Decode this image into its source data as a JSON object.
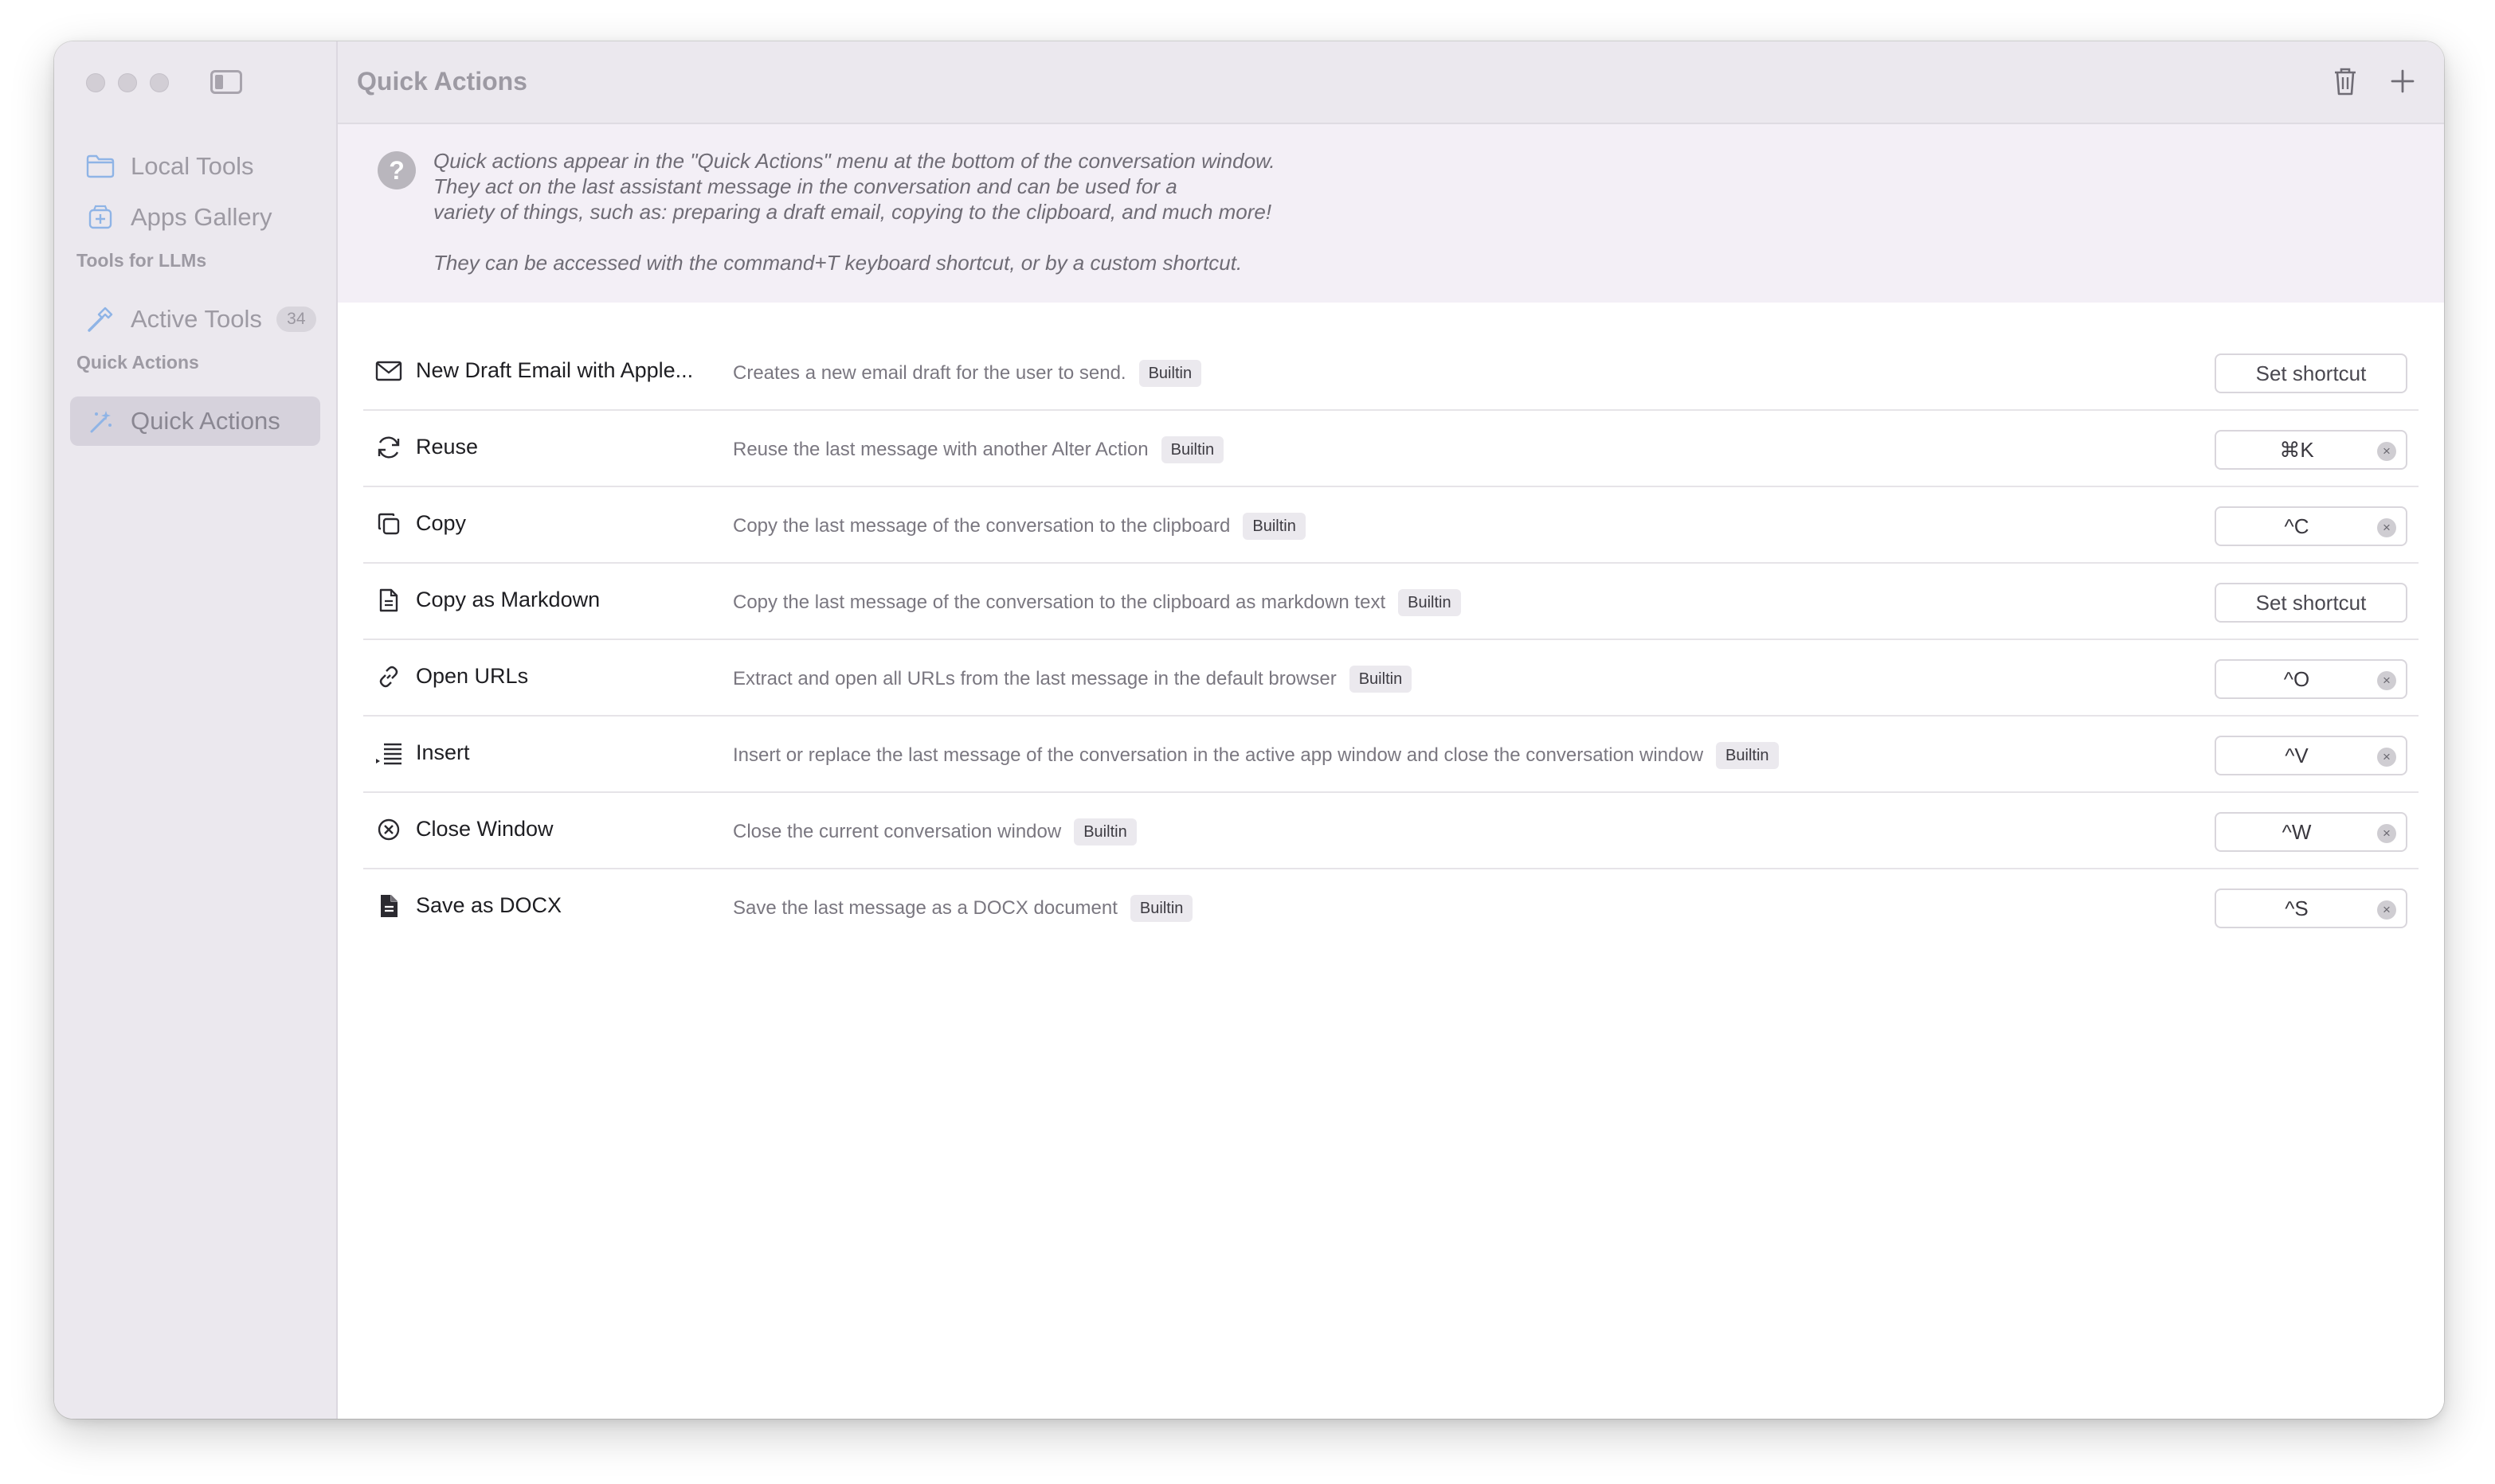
{
  "sidebar": {
    "items": [
      {
        "label": "Local Tools",
        "icon": "folder-icon"
      },
      {
        "label": "Apps Gallery",
        "icon": "app-gallery-icon"
      }
    ],
    "sections": [
      {
        "title": "Tools for LLMs",
        "items": [
          {
            "label": "Active Tools",
            "badge": "34",
            "icon": "hammer-icon"
          }
        ]
      },
      {
        "title": "Quick Actions",
        "items": [
          {
            "label": "Quick Actions",
            "icon": "magic-wand-icon",
            "active": true
          }
        ]
      }
    ]
  },
  "header": {
    "title": "Quick Actions",
    "actions": [
      "trash-icon",
      "plus-icon"
    ]
  },
  "info": {
    "lines": [
      "Quick actions appear in the \"Quick Actions\" menu at the bottom of the conversation window.",
      "They act on the last assistant message in the conversation and can be used for a",
      "variety of things, such as: preparing a draft email, copying to the clipboard, and much more!",
      "They can be accessed with the command+T keyboard shortcut, or by a custom shortcut."
    ]
  },
  "actions": [
    {
      "icon": "envelope-icon",
      "name": "New Draft Email with Apple...",
      "description": "Creates a new email draft for the user to send.",
      "badge": "Builtin",
      "shortcut": "",
      "set_label": "Set shortcut"
    },
    {
      "icon": "refresh-icon",
      "name": "Reuse",
      "description": "Reuse the last message with another Alter Action",
      "badge": "Builtin",
      "shortcut": "⌘K"
    },
    {
      "icon": "copy-icon",
      "name": "Copy",
      "description": "Copy the last message of the conversation to the clipboard",
      "badge": "Builtin",
      "shortcut": "^C"
    },
    {
      "icon": "document-icon",
      "name": "Copy as Markdown",
      "description": "Copy the last message of the conversation to the clipboard as markdown text",
      "badge": "Builtin",
      "shortcut": "",
      "set_label": "Set shortcut"
    },
    {
      "icon": "link-icon",
      "name": "Open URLs",
      "description": "Extract and open all URLs from the last message in the default browser",
      "badge": "Builtin",
      "shortcut": "^O"
    },
    {
      "icon": "insert-lines-icon",
      "name": "Insert",
      "description": "Insert or replace the last message of the conversation in the active app window and close the conversation window",
      "badge": "Builtin",
      "shortcut": "^V"
    },
    {
      "icon": "close-circle-icon",
      "name": "Close Window",
      "description": "Close the current conversation window",
      "badge": "Builtin",
      "shortcut": "^W"
    },
    {
      "icon": "document-filled-icon",
      "name": "Save as DOCX",
      "description": "Save the last message as a DOCX document",
      "badge": "Builtin",
      "shortcut": "^S"
    }
  ],
  "colors": {
    "sidebar_bg": "#ebe8ee",
    "info_bg": "#f3eff6",
    "badge_bg": "#ebe9ee"
  }
}
